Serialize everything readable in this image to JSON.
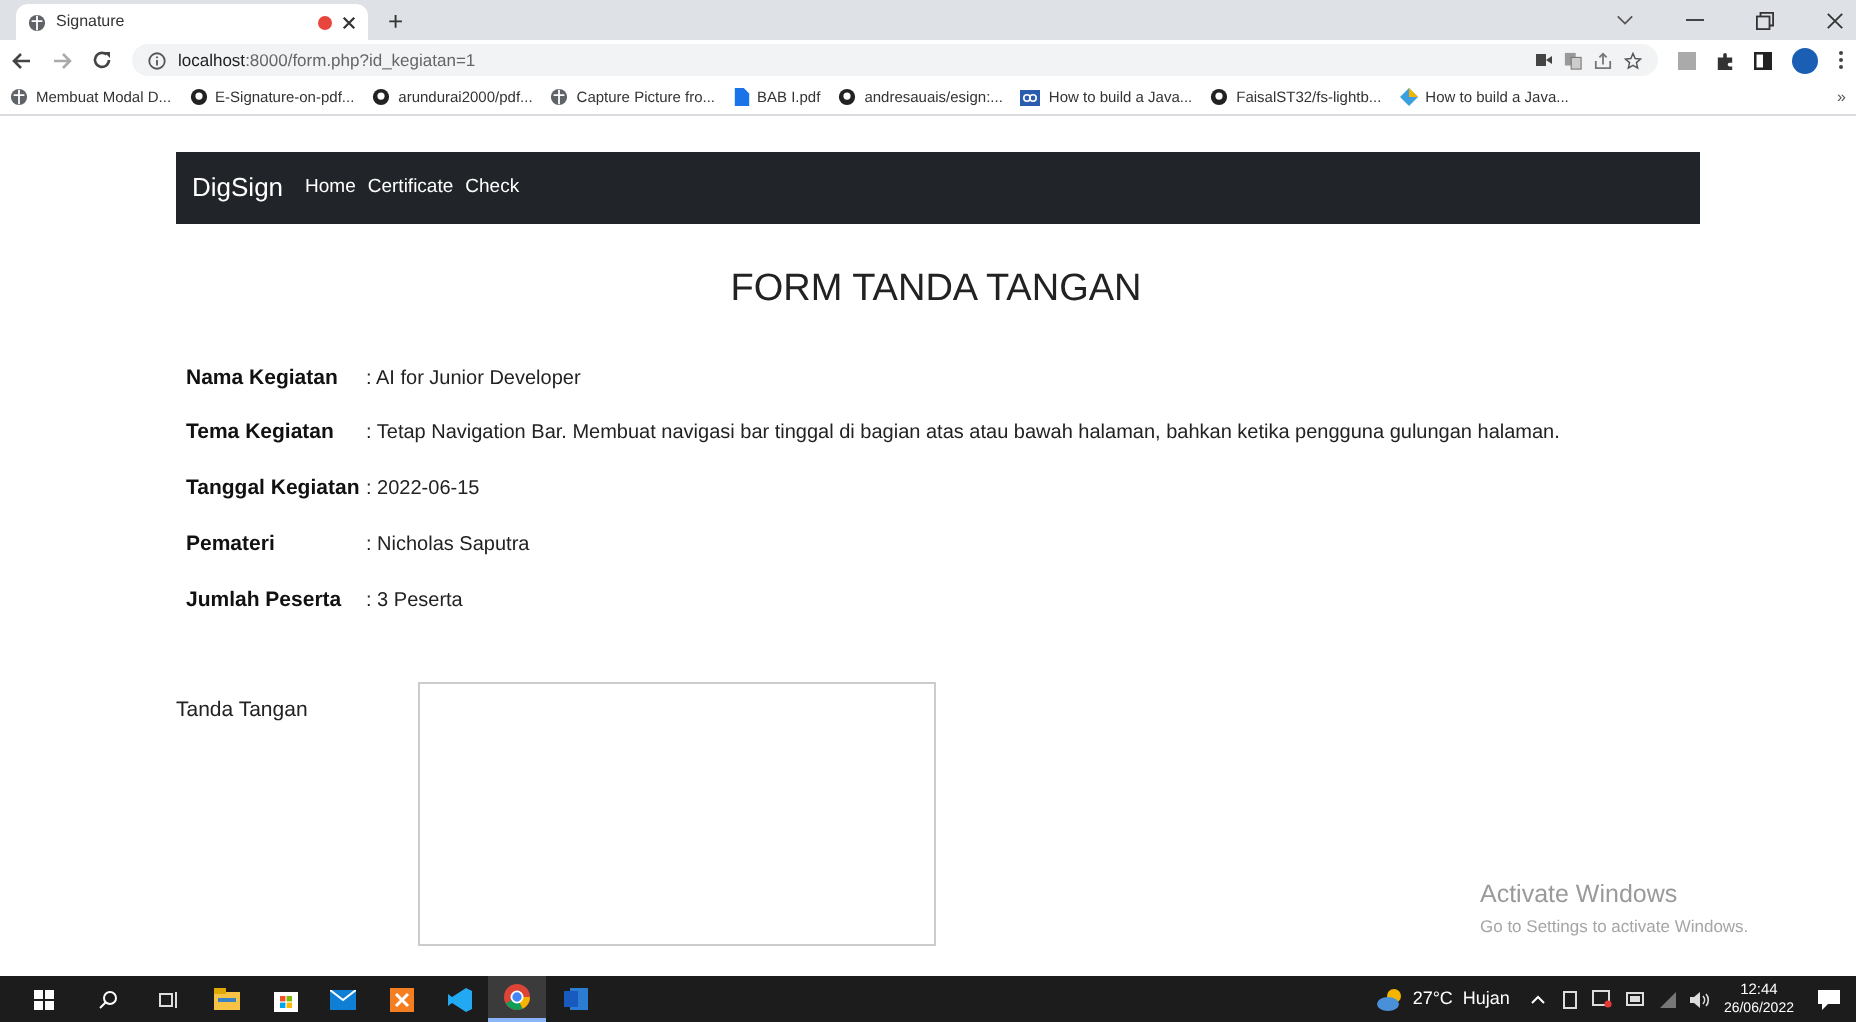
{
  "browser": {
    "tab": {
      "title": "Signature",
      "recording": true
    },
    "new_tab": "+",
    "url_host": "localhost",
    "url_rest": ":8000/form.php?id_kegiatan=1",
    "bookmarks": [
      {
        "label": "Membuat Modal D...",
        "kind": "globe"
      },
      {
        "label": "E-Signature-on-pdf...",
        "kind": "github"
      },
      {
        "label": "arundurai2000/pdf...",
        "kind": "github"
      },
      {
        "label": "Capture Picture fro...",
        "kind": "globe"
      },
      {
        "label": "BAB I.pdf",
        "kind": "doc"
      },
      {
        "label": "andresauais/esign:...",
        "kind": "github"
      },
      {
        "label": "How to build a Java...",
        "kind": "co"
      },
      {
        "label": "FaisalST32/fs-lightb...",
        "kind": "github"
      },
      {
        "label": "How to build a Java...",
        "kind": "diamond"
      }
    ],
    "more": "»"
  },
  "navbar": {
    "brand": "DigSign",
    "links": [
      "Home",
      "Certificate",
      "Check"
    ]
  },
  "title": "FORM TANDA TANGAN",
  "details": [
    {
      "label": "Nama Kegiatan",
      "value": ": AI for Junior Developer"
    },
    {
      "label": "Tema Kegiatan",
      "value": ": Tetap Navigation Bar. Membuat navigasi bar tinggal di bagian atas atau bawah halaman, bahkan ketika pengguna gulungan halaman."
    },
    {
      "label": "Tanggal Kegiatan",
      "value": ": 2022-06-15"
    },
    {
      "label": "Pemateri",
      "value": ": Nicholas Saputra"
    },
    {
      "label": "Jumlah Peserta",
      "value": ": 3 Peserta"
    }
  ],
  "signature": {
    "label": "Tanda Tangan"
  },
  "activation": {
    "title": "Activate Windows",
    "hint": "Go to Settings to activate Windows."
  },
  "taskbar": {
    "weather": "27°C  Hujan",
    "time": "12:44",
    "date": "26/06/2022",
    "apps": [
      {
        "kind": "files",
        "active": false
      },
      {
        "kind": "store",
        "active": false
      },
      {
        "kind": "mail",
        "active": false
      },
      {
        "kind": "xampp",
        "active": false
      },
      {
        "kind": "vscode",
        "active": false
      },
      {
        "kind": "chrome",
        "active": true
      },
      {
        "kind": "word",
        "active": false
      }
    ]
  }
}
